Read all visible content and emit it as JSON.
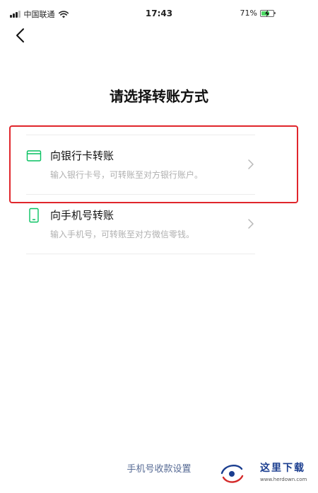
{
  "status_bar": {
    "carrier": "中国联通",
    "time": "17:43",
    "battery_percent": "71%",
    "battery_level": 0.71
  },
  "page": {
    "title": "请选择转账方式"
  },
  "options": [
    {
      "title": "向银行卡转账",
      "description": "输入银行卡号，可转账至对方银行账户。",
      "icon": "bank-card-icon"
    },
    {
      "title": "向手机号转账",
      "description": "输入手机号，可转账至对方微信零钱。",
      "icon": "phone-icon"
    }
  ],
  "footer": {
    "link_label": "手机号收款设置"
  },
  "watermark": {
    "text": "这里下载",
    "url": "www.herdown.com"
  },
  "colors": {
    "accent_green": "#07c160",
    "link_blue": "#576b95",
    "highlight_red": "#e0262c"
  }
}
